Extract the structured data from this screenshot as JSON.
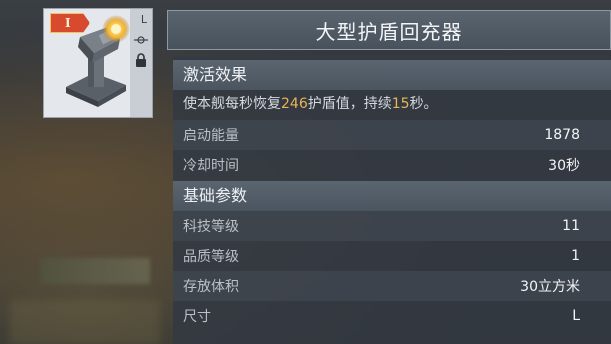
{
  "item": {
    "tier": "I",
    "size_letter": "L",
    "icon": "shield-regenerator-turret-icon",
    "name": "大型护盾回充器"
  },
  "activation": {
    "header": "激活效果",
    "desc_prefix": "使本舰每秒恢复",
    "desc_value1": "246",
    "desc_middle": "护盾值，持续",
    "desc_value2": "15",
    "desc_suffix": "秒。",
    "rows": [
      {
        "label": "启动能量",
        "value": "1878"
      },
      {
        "label": "冷却时间",
        "value": "30秒"
      }
    ]
  },
  "basic": {
    "header": "基础参数",
    "rows": [
      {
        "label": "科技等级",
        "value": "11"
      },
      {
        "label": "品质等级",
        "value": "1"
      },
      {
        "label": "存放体积",
        "value": "30立方米"
      },
      {
        "label": "尺寸",
        "value": "L"
      }
    ]
  },
  "colors": {
    "highlight": "#e8b458",
    "tier_badge": "#d84a2e"
  }
}
